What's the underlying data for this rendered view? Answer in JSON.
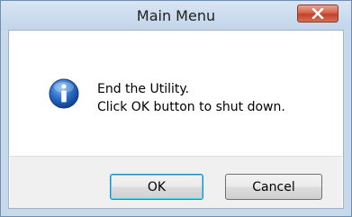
{
  "window": {
    "title": "Main Menu"
  },
  "dialog": {
    "icon": "info-icon",
    "message_line1": "End the Utility.",
    "message_line2": "Click OK button to shut down."
  },
  "buttons": {
    "ok_label": "OK",
    "cancel_label": "Cancel"
  },
  "colors": {
    "title_bar": "#c9d9ec",
    "close_button": "#c7472f",
    "info_icon": "#1d5fb4",
    "footer": "#f0f0f0"
  }
}
